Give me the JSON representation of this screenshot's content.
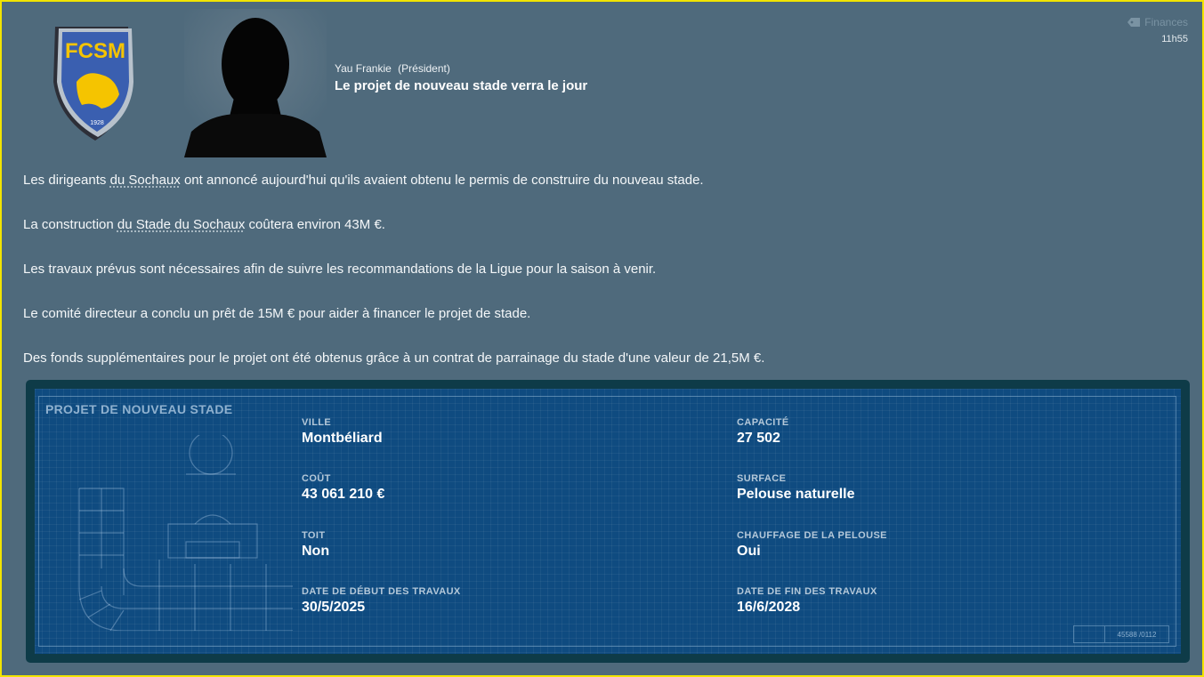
{
  "header": {
    "club_logo": {
      "icon": "fcsm-crest-icon",
      "text": "FCSM",
      "year": "1928"
    },
    "sender_name": "Yau Frankie",
    "sender_role": "(Président)",
    "headline": "Le projet de nouveau stade verra le jour",
    "category": "Finances",
    "category_icon": "tag-icon",
    "time": "11h55"
  },
  "body": {
    "p1": {
      "before": "Les dirigeants ",
      "link": "du Sochaux",
      "after": " ont annoncé aujourd'hui qu'ils avaient obtenu le permis de construire du nouveau stade."
    },
    "p2": {
      "before": "La construction ",
      "link": "du Stade du Sochaux",
      "after": " coûtera environ 43M €."
    },
    "p3": "Les travaux prévus sont nécessaires afin de suivre les recommandations de la Ligue pour la saison à venir.",
    "p4": "Le comité directeur a conclu un prêt de 15M € pour aider à financer le projet de stade.",
    "p5": "Des fonds supplémentaires pour le projet ont été obtenus grâce à un contrat de parrainage du stade d'une valeur de 21,5M €."
  },
  "project": {
    "title": "PROJET DE NOUVEAU STADE",
    "fields": {
      "ville": {
        "label": "VILLE",
        "value": "Montbéliard"
      },
      "capacite": {
        "label": "CAPACITÉ",
        "value": "27 502"
      },
      "cout": {
        "label": "COÛT",
        "value": "43 061 210 €"
      },
      "surface": {
        "label": "SURFACE",
        "value": "Pelouse naturelle"
      },
      "toit": {
        "label": "TOIT",
        "value": "Non"
      },
      "chauffage": {
        "label": "CHAUFFAGE DE LA PELOUSE",
        "value": "Oui"
      },
      "debut": {
        "label": "DATE DE DÉBUT DES TRAVAUX",
        "value": "30/5/2025"
      },
      "fin": {
        "label": "DATE DE FIN DES TRAVAUX",
        "value": "16/6/2028"
      }
    },
    "stamp": "45588 /0112"
  },
  "colors": {
    "background": "#4f6a7c",
    "blueprint": "#0f4b80",
    "crest_yellow": "#f5c400",
    "crest_blue": "#3a5fb0"
  }
}
